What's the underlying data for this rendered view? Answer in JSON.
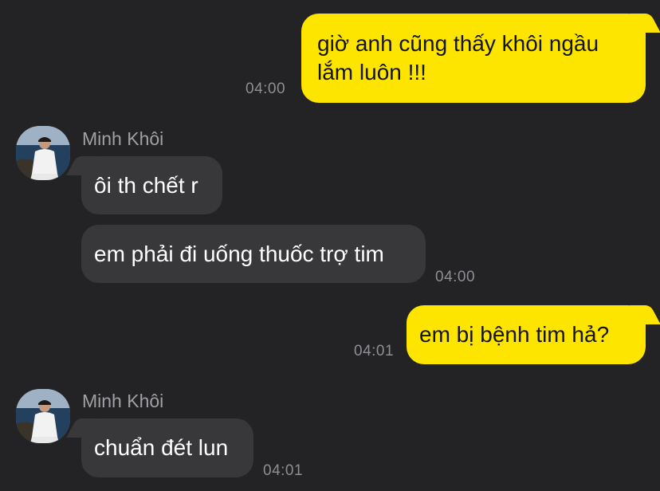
{
  "messages": [
    {
      "direction": "outgoing",
      "text": "giờ anh cũng thấy khôi ngầu lắm luôn !!!",
      "time": "04:00"
    },
    {
      "direction": "incoming",
      "sender": "Minh Khôi",
      "text": "ôi th chết r"
    },
    {
      "direction": "incoming",
      "text": "em phải đi uống thuốc trợ tim",
      "time": "04:00"
    },
    {
      "direction": "outgoing",
      "text": "em bị bệnh tim hả?",
      "time": "04:01"
    },
    {
      "direction": "incoming",
      "sender": "Minh Khôi",
      "text": "chuẩn đét lun",
      "time": "04:01"
    }
  ],
  "colors": {
    "background": "#232326",
    "outgoing_bubble": "#fde500",
    "incoming_bubble": "#38383b",
    "timestamp": "#8e8e93",
    "sender_name": "#a0a0a4"
  }
}
